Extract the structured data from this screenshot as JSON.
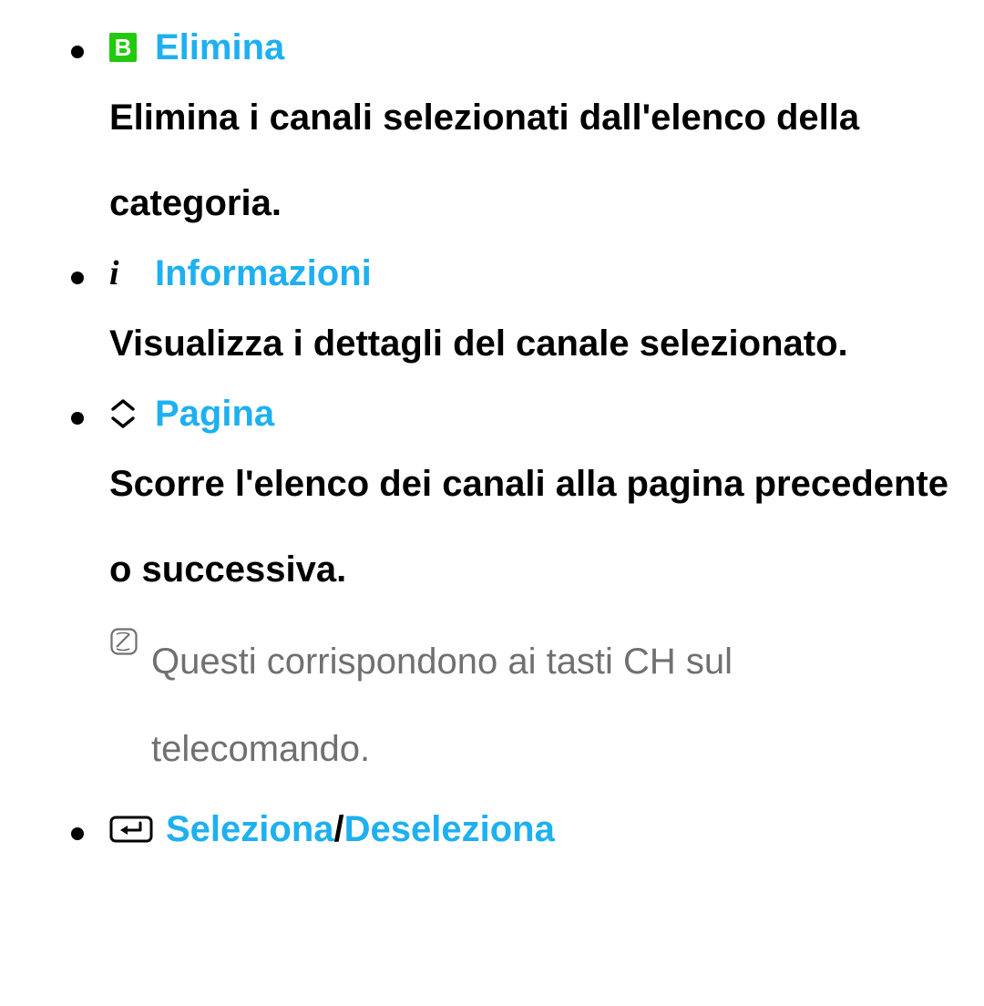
{
  "items": [
    {
      "icon": "b-button",
      "label": "Elimina",
      "desc": "Elimina i canali selezionati dall'elenco della categoria."
    },
    {
      "icon": "info",
      "label": "Informazioni",
      "desc": "Visualizza i dettagli del canale selezionato."
    },
    {
      "icon": "updown",
      "label": "Pagina",
      "desc": "Scorre l'elenco dei canali alla pagina precedente o successiva.",
      "note": "Questi corrispondono ai tasti CH sul telecomando."
    },
    {
      "icon": "enter",
      "label1": "Seleziona",
      "sep": " / ",
      "label2": "Deseleziona"
    }
  ]
}
